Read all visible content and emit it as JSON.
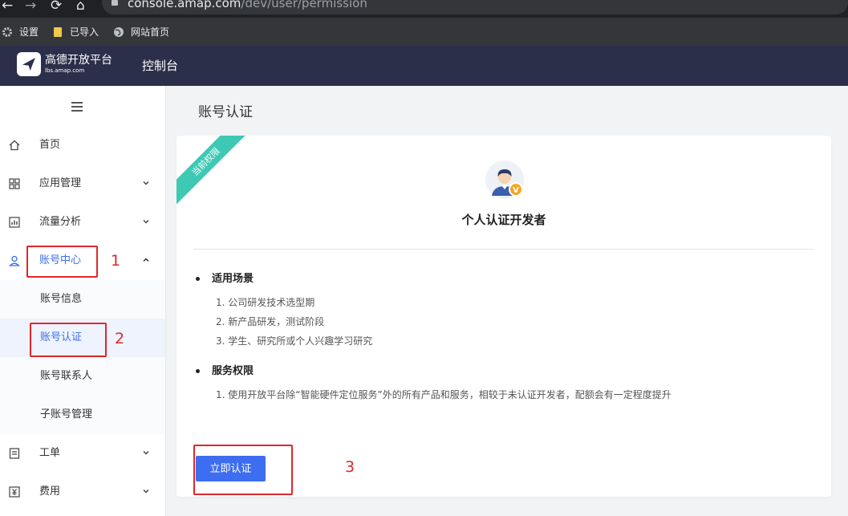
{
  "browser": {
    "url_host": "console.amap.com",
    "url_path": "/dev/user/permission",
    "bookmarks": [
      {
        "label": "设置",
        "icon": "gear-icon"
      },
      {
        "label": "已导入",
        "icon": "folder-icon"
      },
      {
        "label": "网站首页",
        "icon": "globe-icon"
      }
    ]
  },
  "header": {
    "logo_title": "高德开放平台",
    "logo_sub": "lbs.amap.com",
    "console": "控制台"
  },
  "sidebar": {
    "items": [
      {
        "label": "首页",
        "icon": "home-icon"
      },
      {
        "label": "应用管理",
        "icon": "grid-icon"
      },
      {
        "label": "流量分析",
        "icon": "chart-icon"
      },
      {
        "label": "账号中心",
        "icon": "user-icon"
      },
      {
        "label": "工单",
        "icon": "list-icon"
      },
      {
        "label": "费用",
        "icon": "yen-icon"
      }
    ],
    "sub_items": [
      {
        "label": "账号信息"
      },
      {
        "label": "账号认证"
      },
      {
        "label": "账号联系人"
      },
      {
        "label": "子账号管理"
      }
    ]
  },
  "main": {
    "page_title": "账号认证",
    "ribbon": "当前权限",
    "badge": "V",
    "developer_type": "个人认证开发者",
    "sections": [
      {
        "title": "适用场景",
        "items": [
          "1. 公司研发技术选型期",
          "2. 新产品研发，测试阶段",
          "3. 学生、研究所或个人兴趣学习研究"
        ]
      },
      {
        "title": "服务权限",
        "items": [
          "1. 使用开放平台除“智能硬件定位服务”外的所有产品和服务，相较于未认证开发者，配额会有一定程度提升"
        ]
      }
    ],
    "verify_button": "立即认证"
  },
  "annotations": [
    "1",
    "2",
    "3"
  ],
  "colors": {
    "accent": "#3d6df0",
    "header_bg": "#2b2f4a",
    "ribbon": "#3ec9b4",
    "annotation": "#e0262c"
  }
}
